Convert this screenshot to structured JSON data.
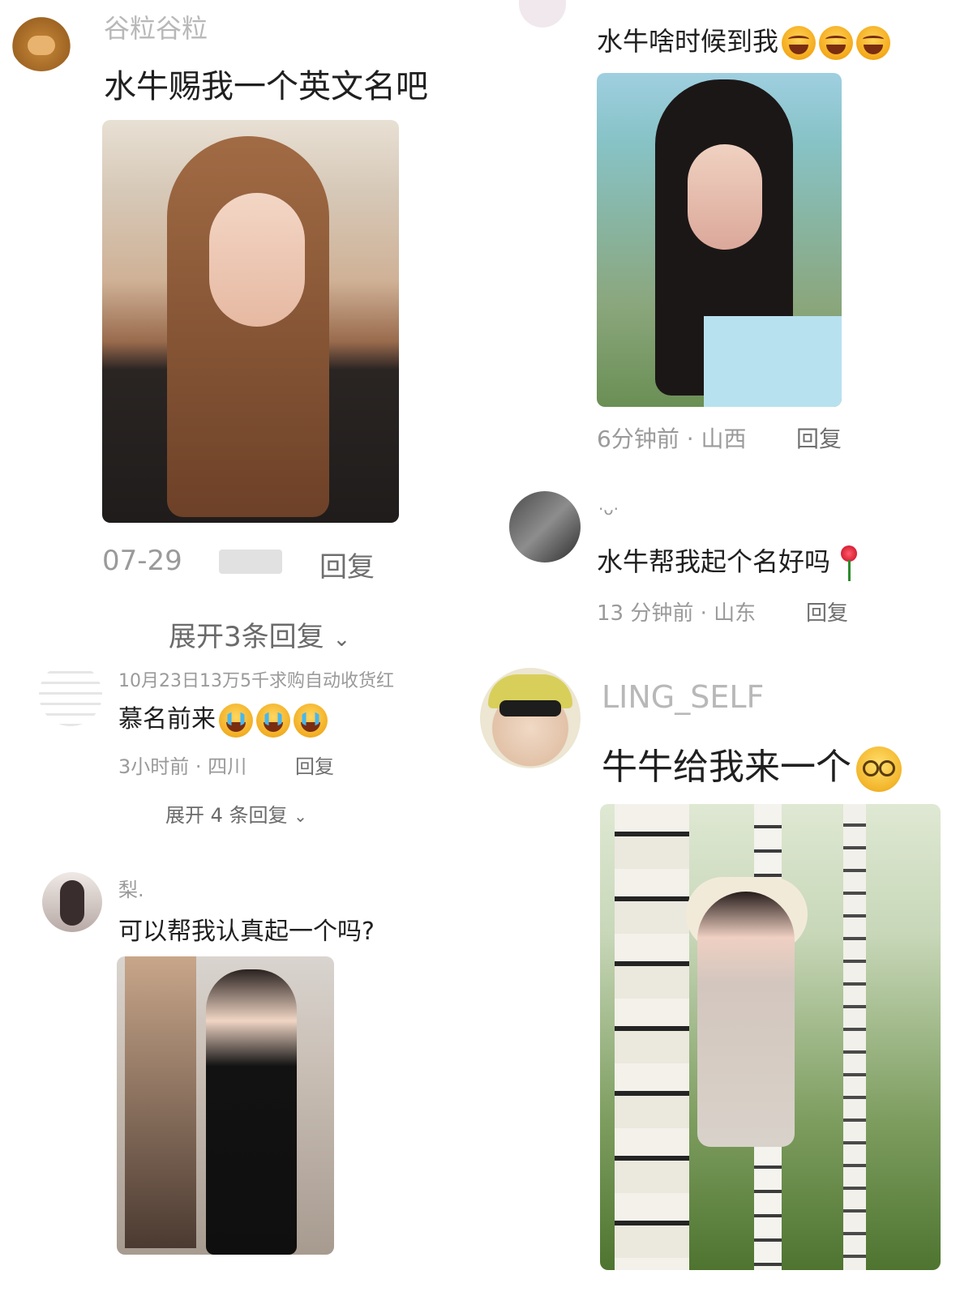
{
  "left": {
    "comment1": {
      "username": "谷粒谷粒",
      "text": "水牛赐我一个英文名吧",
      "date": "07-29",
      "reply_label": "回复",
      "expand": "展开3条回复"
    },
    "comment2": {
      "username": "10月23日13万5千求购自动收货红",
      "text": "慕名前来",
      "time_location": "3小时前 · 四川",
      "reply_label": "回复",
      "expand": "展开 4 条回复"
    },
    "comment3": {
      "username": "梨.",
      "text": "可以帮我认真起一个吗?"
    }
  },
  "right": {
    "comment1": {
      "text": "水牛啥时候到我",
      "time_location": "6分钟前 · 山西",
      "reply_label": "回复"
    },
    "comment2": {
      "username": "·ᴗ·",
      "text": "水牛帮我起个名好吗",
      "time_location": "13 分钟前 · 山东",
      "reply_label": "回复"
    },
    "comment3": {
      "username": "LING_SELF",
      "text": "牛牛给我来一个"
    }
  },
  "icons": {
    "expand": "chevron-down-icon",
    "cry_emoji": "crying-face-emoji",
    "nerd_emoji": "nerd-face-emoji",
    "rose": "rose-emoji"
  }
}
